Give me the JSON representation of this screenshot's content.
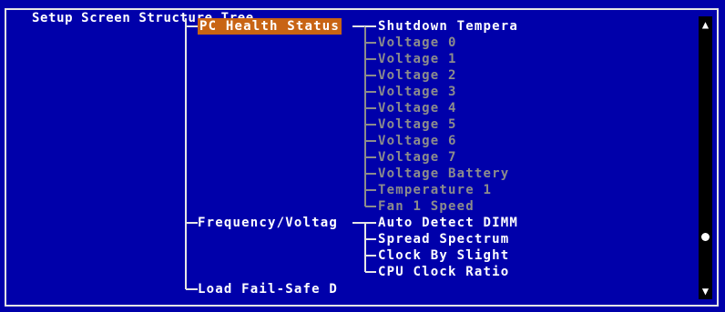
{
  "window": {
    "title": "Setup Screen Structure Tree"
  },
  "tree": {
    "level1": [
      {
        "label": "PC Health Status",
        "state": "selected"
      },
      {
        "label": "Frequency/Voltag",
        "state": "active"
      },
      {
        "label": "Load Fail-Safe D",
        "state": "active"
      }
    ],
    "pc_health_children": [
      {
        "label": "Shutdown Tempera",
        "state": "active"
      },
      {
        "label": "Voltage 0",
        "state": "dim"
      },
      {
        "label": "Voltage 1",
        "state": "dim"
      },
      {
        "label": "Voltage 2",
        "state": "dim"
      },
      {
        "label": "Voltage 3",
        "state": "dim"
      },
      {
        "label": "Voltage 4",
        "state": "dim"
      },
      {
        "label": "Voltage 5",
        "state": "dim"
      },
      {
        "label": "Voltage 6",
        "state": "dim"
      },
      {
        "label": "Voltage 7",
        "state": "dim"
      },
      {
        "label": "Voltage Battery",
        "state": "dim"
      },
      {
        "label": "Temperature 1",
        "state": "dim"
      },
      {
        "label": "Fan 1 Speed",
        "state": "dim"
      }
    ],
    "frequency_children": [
      {
        "label": "Auto Detect DIMM",
        "state": "active"
      },
      {
        "label": "Spread Spectrum",
        "state": "active"
      },
      {
        "label": "Clock By Slight",
        "state": "active"
      },
      {
        "label": "CPU Clock Ratio",
        "state": "active"
      }
    ]
  },
  "scrollbar": {
    "up_icon": "up-arrow-icon",
    "down_icon": "down-arrow-icon",
    "thumb_icon": "scroll-thumb-icon"
  },
  "colors": {
    "background": "#0000aa",
    "text_active": "#ffffff",
    "text_dim": "#8c8c8c",
    "selection": "#c86414",
    "lines": "#e6e6e6"
  }
}
